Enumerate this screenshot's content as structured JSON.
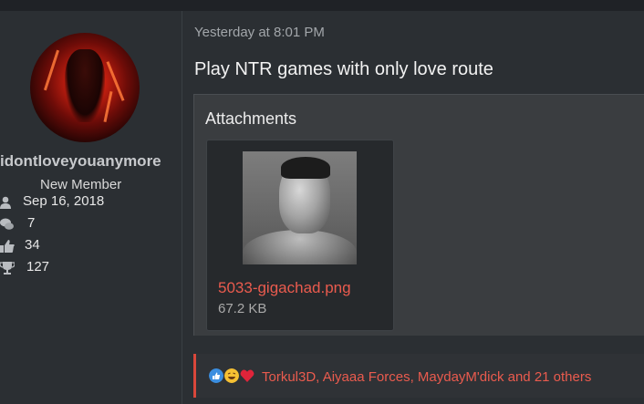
{
  "user": {
    "username": "idontloveyouanymore",
    "title": "New Member",
    "joined": "Sep 16, 2018",
    "messages": "7",
    "reactions": "34",
    "points": "127"
  },
  "post": {
    "timestamp": "Yesterday at 8:01 PM",
    "message": "Play NTR games with only love route",
    "attachments_title": "Attachments",
    "attachment": {
      "filename": "5033-gigachad.png",
      "size": "67.2 KB"
    }
  },
  "reactions": {
    "icons": [
      "like-icon",
      "laugh-icon",
      "heart-icon"
    ],
    "text": "Torkul3D, Aiyaaa Forces, MaydayM'dick and 21 others"
  },
  "colors": {
    "background": "#2b2f33",
    "accent": "#ea5b4e",
    "attachments_bg": "#3a3d40"
  }
}
